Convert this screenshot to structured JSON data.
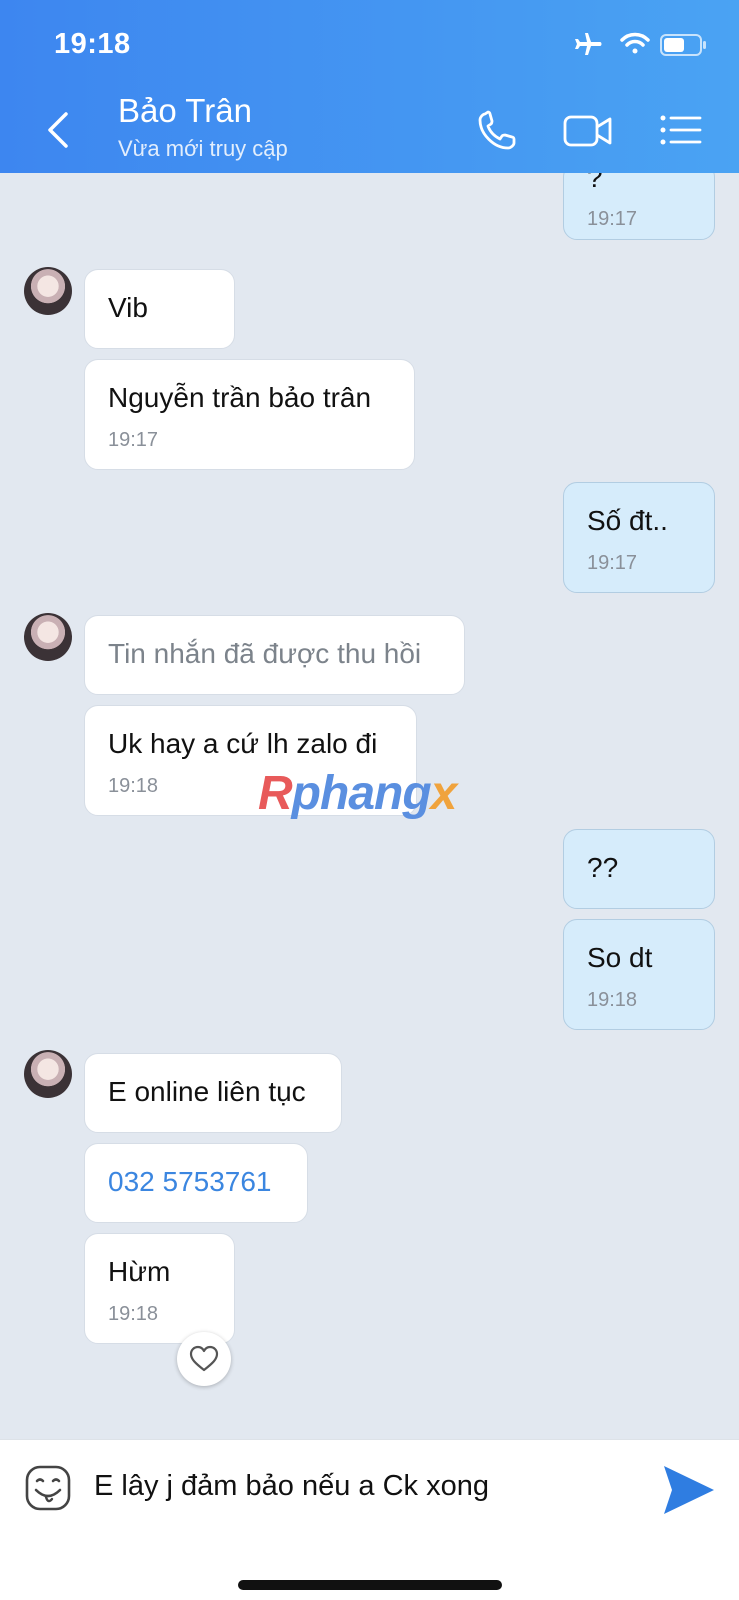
{
  "status_bar": {
    "time": "19:18",
    "icons": [
      "airplane-icon",
      "wifi-icon",
      "battery-icon"
    ]
  },
  "header": {
    "title": "Bảo Trân",
    "subtitle": "Vừa mới truy cập",
    "actions": [
      "phone-icon",
      "video-call-icon",
      "menu-list-icon"
    ]
  },
  "messages": [
    {
      "dir": "out",
      "text": "?",
      "time": "19:17"
    },
    {
      "dir": "in",
      "text": "Vib",
      "time": ""
    },
    {
      "dir": "in",
      "text": "Nguyễn trần bảo trân",
      "time": "19:17"
    },
    {
      "dir": "out",
      "text": "Số đt..",
      "time": "19:17"
    },
    {
      "dir": "in",
      "text": "Tin nhắn đã được thu hồi",
      "time": ""
    },
    {
      "dir": "in",
      "text": "Uk hay a cứ lh zalo đi",
      "time": "19:18"
    },
    {
      "dir": "out",
      "text": "??",
      "time": ""
    },
    {
      "dir": "out",
      "text": "So dt",
      "time": "19:18"
    },
    {
      "dir": "in",
      "text": "E online liên tục",
      "time": ""
    },
    {
      "dir": "in",
      "text": "032 5753761",
      "time": ""
    },
    {
      "dir": "in",
      "text": "Hừm",
      "time": "19:18"
    }
  ],
  "watermark": {
    "p1": "R",
    "p2": "phang",
    "p3": "x"
  },
  "composer": {
    "draft": "E lây j đảm bảo nếu a Ck xong"
  },
  "colors": {
    "header_start": "#3d86f0",
    "header_end": "#4aa3f3",
    "out_bubble": "#d6ecfb",
    "in_bubble": "#ffffff",
    "link": "#3b86e0",
    "send": "#2f7de1"
  }
}
